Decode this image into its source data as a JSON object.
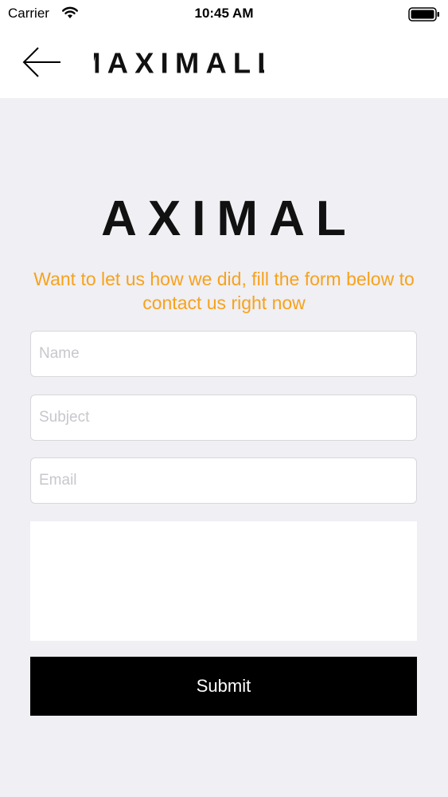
{
  "status_bar": {
    "carrier": "Carrier",
    "time": "10:45 AM",
    "wifi_icon": "wifi-icon",
    "battery_icon": "battery-icon"
  },
  "nav": {
    "back_icon": "arrow-left-icon",
    "logo_text": "MAXIMALL"
  },
  "main": {
    "logo_text": "MAXIMALL",
    "intro": "Want to let us how we did, fill the form below to contact us right now"
  },
  "form": {
    "name_placeholder": "Name",
    "subject_placeholder": "Subject",
    "email_placeholder": "Email",
    "message_placeholder": "",
    "submit_label": "Submit"
  },
  "colors": {
    "accent": "#f7a21b",
    "logo_mark": "#e8483a",
    "background": "#efeff4",
    "button": "#000000"
  }
}
